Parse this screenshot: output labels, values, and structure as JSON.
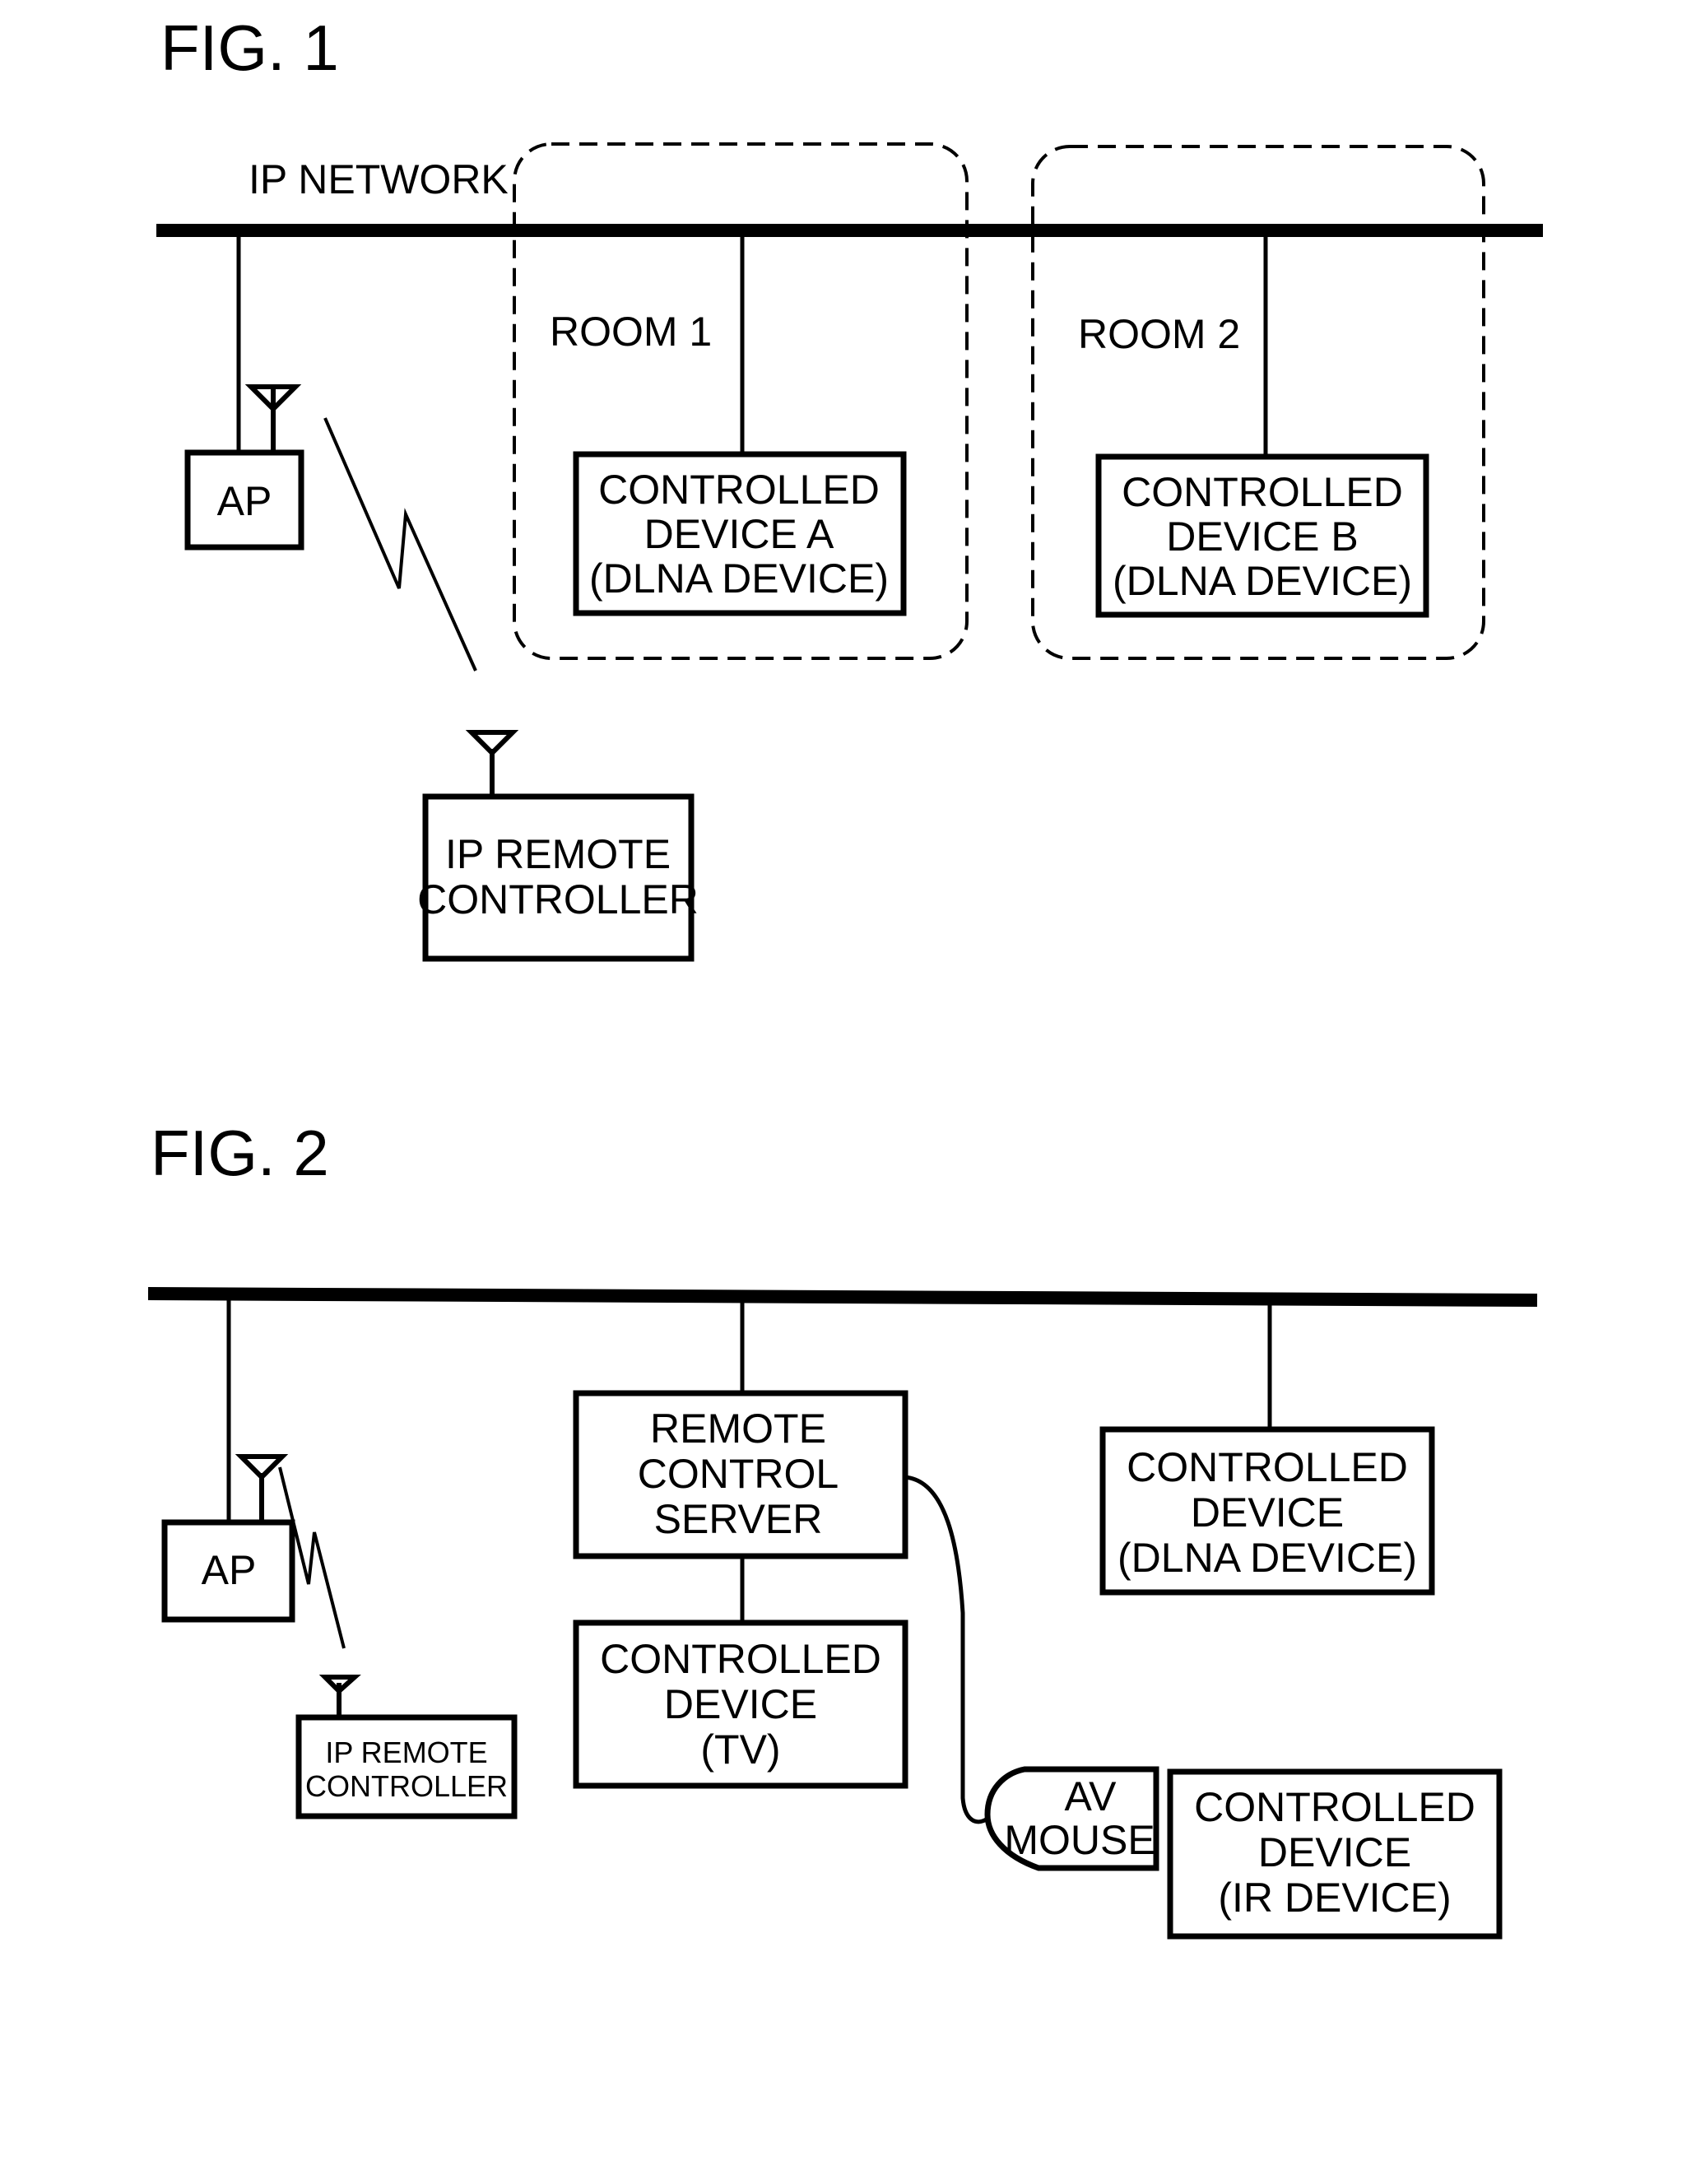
{
  "figures": [
    {
      "title": "FIG. 1",
      "network_label": "IP NETWORK",
      "rooms": [
        {
          "label": "ROOM 1"
        },
        {
          "label": "ROOM 2"
        }
      ],
      "nodes": {
        "ap": {
          "lines": [
            "AP"
          ]
        },
        "device_a": {
          "lines": [
            "CONTROLLED",
            "DEVICE A",
            "(DLNA DEVICE)"
          ]
        },
        "device_b": {
          "lines": [
            "CONTROLLED",
            "DEVICE B",
            "(DLNA DEVICE)"
          ]
        },
        "remote": {
          "lines": [
            "IP REMOTE",
            "CONTROLLER"
          ]
        }
      }
    },
    {
      "title": "FIG. 2",
      "nodes": {
        "ap": {
          "lines": [
            "AP"
          ]
        },
        "server": {
          "lines": [
            "REMOTE",
            "CONTROL",
            "SERVER"
          ]
        },
        "dlna": {
          "lines": [
            "CONTROLLED",
            "DEVICE",
            "(DLNA DEVICE)"
          ]
        },
        "tv": {
          "lines": [
            "CONTROLLED",
            "DEVICE",
            "(TV)"
          ]
        },
        "av_mouse": {
          "lines": [
            "AV",
            "MOUSE"
          ]
        },
        "ir": {
          "lines": [
            "CONTROLLED",
            "DEVICE",
            "(IR DEVICE)"
          ]
        },
        "remote": {
          "lines": [
            "IP REMOTE",
            "CONTROLLER"
          ]
        }
      }
    }
  ]
}
